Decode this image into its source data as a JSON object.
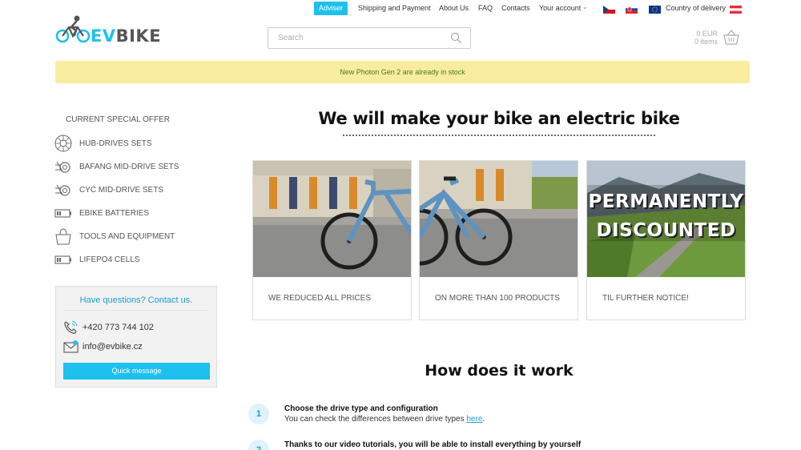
{
  "topnav": {
    "adviser": "Adviser",
    "links": [
      "Shipping and Payment",
      "About Us",
      "FAQ",
      "Contacts",
      "Your account"
    ],
    "account_caret": "⌄",
    "country_label": "Country of delivery"
  },
  "header": {
    "logo_text_a": "EV",
    "logo_text_b": "BIKE",
    "search_placeholder": "Search",
    "cart_amount": "0 EUR",
    "cart_items": "0 items"
  },
  "banner": {
    "text": "New Photon Gen 2 are already in stock"
  },
  "sidebar": {
    "title": "CURRENT SPECIAL OFFER",
    "items": [
      {
        "label": "HUB-DRIVES SETS",
        "icon": "hub-motor-icon"
      },
      {
        "label": "BAFANG MID-DRIVE SETS",
        "icon": "mid-drive-icon"
      },
      {
        "label": "CYC MID-DRIVE SETS",
        "icon": "mid-drive-icon"
      },
      {
        "label": "EBIKE BATTERIES",
        "icon": "battery-icon"
      },
      {
        "label": "TOOLS AND EQUIPMENT",
        "icon": "bag-icon"
      },
      {
        "label": "LIFEPO4 CELLS",
        "icon": "battery-icon"
      }
    ],
    "contact": {
      "heading": "Have questions? Contact us.",
      "phone": "+420 773 744 102",
      "email": "info@evbike.cz",
      "button": "Quick message"
    }
  },
  "main": {
    "title": "We will make your bike an electric bike",
    "cards": [
      {
        "label": "WE REDUCED ALL PRICES"
      },
      {
        "label": "ON MORE THAN 100 PRODUCTS"
      },
      {
        "label": "TIL FURTHER NOTICE!",
        "overlay_line1": "PERMANENTLY",
        "overlay_line2": "DISCOUNTED"
      }
    ],
    "how_title": "How does it work",
    "steps": [
      {
        "num": "1",
        "title": "Choose the drive type and configuration",
        "text": "You can check the differences between drive types ",
        "link": "here",
        "text_end": "."
      },
      {
        "num": "2",
        "title": "Thanks to our video tutorials, you will be able to install everything by yourself"
      }
    ]
  },
  "colors": {
    "accent": "#1ec0ee",
    "banner_bg": "#f8ed9f",
    "banner_text": "#4a7a1c",
    "link": "#1a9ed0"
  }
}
